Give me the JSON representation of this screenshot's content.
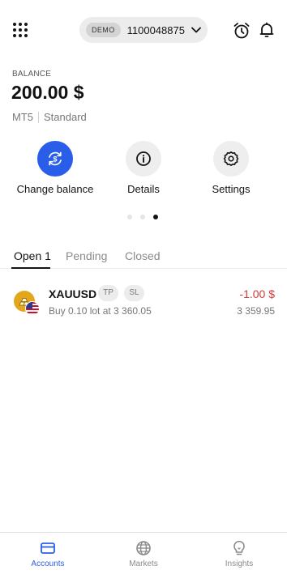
{
  "header": {
    "account_type": "DEMO",
    "account_number": "1100048875"
  },
  "balance": {
    "label": "BALANCE",
    "value": "200.00 $",
    "platform": "MT5",
    "account_kind": "Standard"
  },
  "actions": [
    {
      "label": "Change balance",
      "icon": "change-balance-icon"
    },
    {
      "label": "Details",
      "icon": "info-icon"
    },
    {
      "label": "Settings",
      "icon": "gear-icon"
    }
  ],
  "carousel": {
    "pages": 3,
    "active_index": 2
  },
  "tabs": [
    {
      "label": "Open 1",
      "active": true
    },
    {
      "label": "Pending",
      "active": false
    },
    {
      "label": "Closed",
      "active": false
    }
  ],
  "positions": [
    {
      "symbol": "XAUUSD",
      "tags": [
        "TP",
        "SL"
      ],
      "description": "Buy 0.10 lot at 3 360.05",
      "pnl": "-1.00 $",
      "current_price": "3 359.95"
    }
  ],
  "bottom_nav": [
    {
      "label": "Accounts",
      "icon": "card-icon",
      "active": true
    },
    {
      "label": "Markets",
      "icon": "globe-icon",
      "active": false
    },
    {
      "label": "Insights",
      "icon": "lightbulb-icon",
      "active": false
    }
  ],
  "colors": {
    "accent": "#2b5ee8",
    "loss": "#d23b3b",
    "gold": "#e2a71c"
  }
}
